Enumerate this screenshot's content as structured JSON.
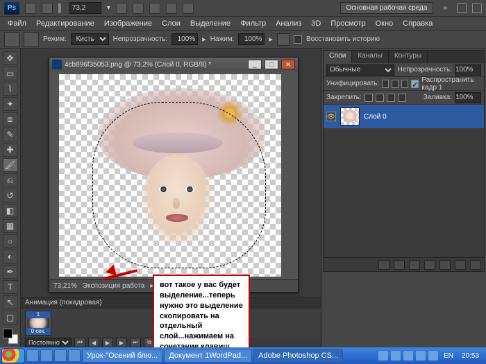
{
  "topbar": {
    "zoom_field": "73,2",
    "workspace": "Основная рабочая среда"
  },
  "menu": [
    "Файл",
    "Редактирование",
    "Изображение",
    "Слои",
    "Выделение",
    "Фильтр",
    "Анализ",
    "3D",
    "Просмотр",
    "Окно",
    "Справка"
  ],
  "options": {
    "mode_label": "Режим:",
    "mode_value": "Кисть",
    "opacity_label": "Непрозрачность:",
    "opacity_value": "100%",
    "flow_label": "Нажим:",
    "flow_value": "100%",
    "restore": "Восстановить историю"
  },
  "doc": {
    "title": "4cb896f35053.png @ 73,2% (Слой 0, RGB/8) *",
    "zoom": "73,21%",
    "status": "Экспозиция работа"
  },
  "note": "вот такое у вас будет выделение...теперь нужно это выделение скопировать на отдельный слой...нажимаем на сочетание клавиш Ctrl+J",
  "anim": {
    "title": "Анимация (покадровая)",
    "frame_num": "1",
    "frame_time": "0 сек.",
    "loop": "Постоянно"
  },
  "layers": {
    "tabs": [
      "Слои",
      "Каналы",
      "Контуры"
    ],
    "blend": "Обычные",
    "opacity_label": "Непрозрачность:",
    "opacity": "100%",
    "unify": "Унифицировать:",
    "propagate": "Распространить кадр 1",
    "lock": "Закрепить:",
    "fill_label": "Заливка:",
    "fill": "100%",
    "item": "Слой 0"
  },
  "taskbar": {
    "tasks": [
      "Урок-\"Осений блю...",
      "Документ 1WordPad...",
      "Adobe Photoshop CS..."
    ],
    "lang": "EN",
    "clock": "20:53"
  }
}
